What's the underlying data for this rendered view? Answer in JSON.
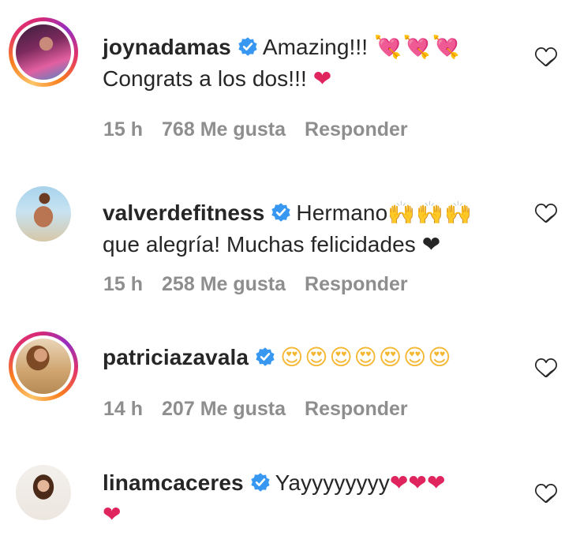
{
  "verified_color": "#3897f0",
  "accent_heart": "#e0245e",
  "comments": [
    {
      "username": "joynadamas",
      "has_story": true,
      "text_line1": "Amazing!!! ",
      "emoji_line1": "💘💘💘",
      "text_line2": "Congrats a los dos!!! ",
      "emoji_line2": "❤",
      "time": "15 h",
      "likes": "768 Me gusta",
      "reply": "Responder"
    },
    {
      "username": "valverdefitness",
      "has_story": false,
      "text_line1": "Hermano",
      "emoji_line1": "🙌🙌🙌",
      "text_line2": "que alegría! Muchas felicidades ",
      "emoji_line2": "❤",
      "time": "15 h",
      "likes": "258 Me gusta",
      "reply": "Responder"
    },
    {
      "username": "patriciazavala",
      "has_story": true,
      "emoji_line1": "😍😍😍😍😍😍😍",
      "time": "14 h",
      "likes": "207 Me gusta",
      "reply": "Responder"
    },
    {
      "username": "linamcaceres",
      "has_story": false,
      "text_line1": "Yayyyyyyyy",
      "emoji_line1": "❤❤❤",
      "emoji_line2": "❤"
    }
  ]
}
